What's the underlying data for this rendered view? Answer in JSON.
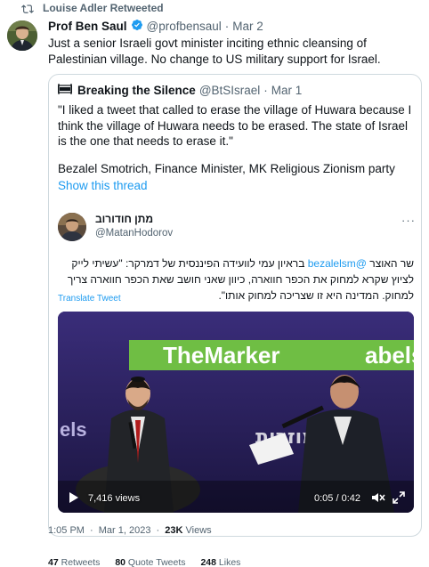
{
  "retweet_banner": {
    "text": "Louise Adler Retweeted",
    "icon": "retweet-icon"
  },
  "tweet": {
    "name": "Prof Ben Saul",
    "handle": "@profbensaul",
    "sep": "·",
    "date": "Mar 2",
    "text": "Just a senior Israeli govt minister inciting ethnic cleansing of Palestinian village. No change to US military support for Israel."
  },
  "quote": {
    "name": "Breaking the Silence",
    "handle": "@BtSIsrael",
    "sep": "·",
    "date": "Mar 1",
    "text": "\"I liked a tweet that called to erase the village of Huwara because I think the village of Huwara needs to be erased. The state of Israel is the one that needs to erase it.\"",
    "attribution": "Bezalel Smotrich, Finance Minister, MK Religious Zionism party",
    "show_thread": "Show this thread"
  },
  "embedded": {
    "name": "מתן חודורוב",
    "handle": "@MatanHodorov",
    "more": "···",
    "text_prefix": "שר האוצר",
    "mention": "@bezalelsm",
    "text_rest": "בראיון עמי לוועידה הפיננסית של דמרקר: \"עשיתי לייק לציוץ שקרא למחוק את הכפר חווארה, כיוון שאני חושב שאת הכפר חווארה צריך למחוק. המדינה היא זו שצריכה למחוק אותו\".",
    "translate": "Translate Tweet"
  },
  "video": {
    "views": "7,416 views",
    "time": "0:05 / 0:42",
    "banner_text": "TheMarker",
    "banner_text_right": "abels",
    "banner_left": "els",
    "banner_hebrew": "מוזרות"
  },
  "footer": {
    "time": "1:05 PM",
    "sep": "·",
    "date": "Mar 1, 2023",
    "views_count": "23K",
    "views_label": "Views"
  },
  "stats": {
    "retweets_count": "47",
    "retweets_label": "Retweets",
    "quotes_count": "80",
    "quotes_label": "Quote Tweets",
    "likes_count": "248",
    "likes_label": "Likes"
  },
  "colors": {
    "link": "#1d9bf0",
    "muted": "#536471",
    "text": "#0f1419",
    "border": "#cfd9de",
    "banner_green": "#6fbe44",
    "video_bg": "#2b2160"
  }
}
